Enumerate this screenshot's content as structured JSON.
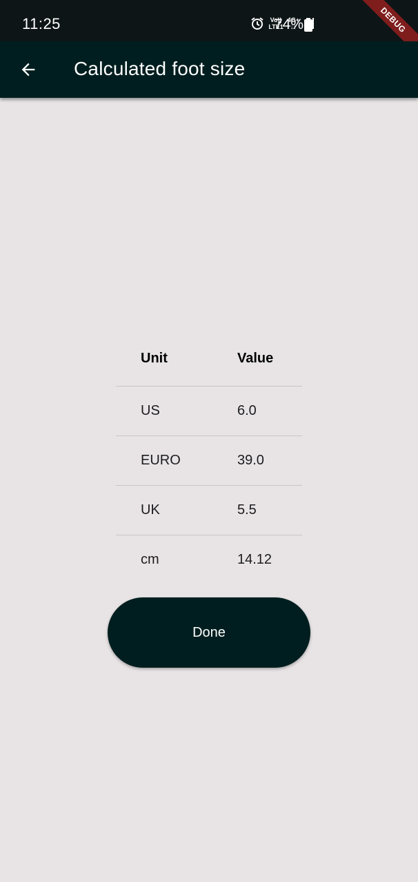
{
  "status_bar": {
    "time": "11:25",
    "volte_top": "Vo))",
    "volte_bottom": "LTE1",
    "network_top": "4G+",
    "network_bottom": "↓↑",
    "battery": "74%"
  },
  "debug_banner": "DEBUG",
  "app_bar": {
    "title": "Calculated foot size"
  },
  "table": {
    "headers": {
      "unit": "Unit",
      "value": "Value"
    },
    "rows": [
      {
        "unit": "US",
        "value": "6.0"
      },
      {
        "unit": "EURO",
        "value": "39.0"
      },
      {
        "unit": "UK",
        "value": "5.5"
      },
      {
        "unit": "cm",
        "value": "14.12"
      }
    ]
  },
  "done_button": {
    "label": "Done"
  },
  "colors": {
    "app_bar": "#001e1f",
    "background": "#e8e4e5",
    "debug": "#7f1d1d"
  }
}
